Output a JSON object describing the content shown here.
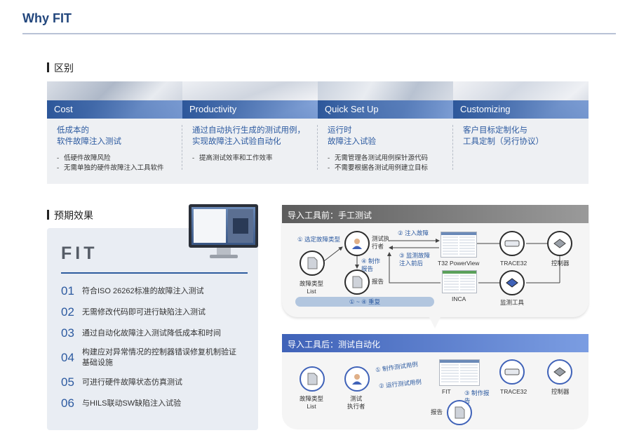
{
  "page": {
    "title": "Why FIT"
  },
  "difference": {
    "heading": "区别",
    "cards": [
      {
        "title": "Cost",
        "lead": "低成本的\n软件故障注入测试",
        "bullets": [
          "低硬件故障风险",
          "无需单独的硬件故障注入工具软件"
        ]
      },
      {
        "title": "Productivity",
        "lead": "通过自动执行生成的测试用例，\n实现故障注入试验自动化",
        "bullets": [
          "提高测试效率和工作效率"
        ]
      },
      {
        "title": "Quick Set Up",
        "lead": "运行时\n故障注入试验",
        "bullets": [
          "无需管理各测试用例探针源代码",
          "不需要根据各测试用例建立目标"
        ]
      },
      {
        "title": "Customizing",
        "lead": "客户目标定制化与\n工具定制（另行协议）",
        "bullets": []
      }
    ]
  },
  "effects": {
    "heading": "预期效果",
    "logo": "FIT",
    "items": [
      {
        "num": "01",
        "text": "符合ISO 26262标准的故障注入测试"
      },
      {
        "num": "02",
        "text": "无需修改代码即可进行缺陷注入测试"
      },
      {
        "num": "03",
        "text": "通过自动化故障注入测试降低成本和时间"
      },
      {
        "num": "04",
        "text": "构建应对异常情况的控制器错误修复机制验证基础设施"
      },
      {
        "num": "05",
        "text": "可进行硬件故障状态仿真测试"
      },
      {
        "num": "06",
        "text": "与HILS联动SW缺陷注入试验"
      }
    ]
  },
  "before": {
    "header": "导入工具前：手工测试",
    "step1": "① 选定故障类型",
    "step2": "② 注入故障",
    "step3": "③ 监测故障\n注入前后",
    "step4": "④ 制作\n报告",
    "tester": "测试执\n行者",
    "fault_list": "故障类型\nList",
    "report": "报告",
    "t32": "T32 PowerView",
    "trace32": "TRACE32",
    "controller": "控制器",
    "inca": "INCA",
    "monitor_tool": "监测工具",
    "repeat": "① ~ ④ 重复"
  },
  "after": {
    "header": "导入工具后：测试自动化",
    "fault_list": "故障类型\nList",
    "tester": "测试\n执行者",
    "step1": "① 制作测试用例",
    "step2": "② 运行测试用例",
    "fit": "FIT",
    "step3": "③ 制作报\n告",
    "report": "报告",
    "trace32": "TRACE32",
    "controller": "控制器"
  },
  "colors": {
    "title": "#23477d",
    "accent": "#2c5aa0",
    "after_header": "#3f62b8",
    "before_header": "#5c5c5c"
  }
}
